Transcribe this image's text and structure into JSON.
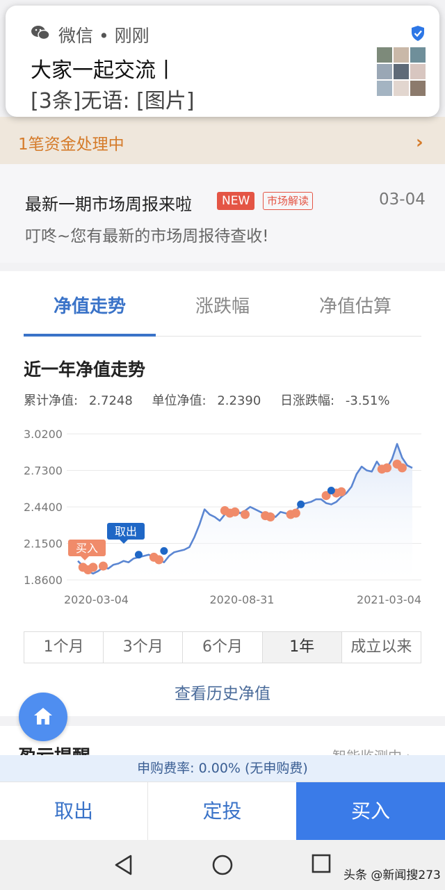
{
  "notification": {
    "app_name": "微信",
    "separator": "•",
    "time": "刚刚",
    "title": "大家一起交流丨",
    "message": "[3条]无语: [图片]"
  },
  "funds_bar": {
    "text": "1笔资金处理中",
    "chevron": "›"
  },
  "report": {
    "title": "最新一期市场周报来啦",
    "badge_new": "NEW",
    "badge_tag": "市场解读",
    "date": "03-04",
    "subtitle": "叮咚~您有最新的市场周报待查收!"
  },
  "tabs": [
    {
      "label": "净值走势",
      "active": true
    },
    {
      "label": "涨跌幅",
      "active": false
    },
    {
      "label": "净值估算",
      "active": false
    }
  ],
  "section_title": "近一年净值走势",
  "metrics": {
    "cumulative_label": "累计净值:",
    "cumulative_value": "2.7248",
    "unit_label": "单位净值:",
    "unit_value": "2.2390",
    "daily_label": "日涨跌幅:",
    "daily_value": "-3.51%"
  },
  "chart_data": {
    "type": "line",
    "y_ticks": [
      "3.0200",
      "2.7300",
      "2.4400",
      "2.1500",
      "1.8600"
    ],
    "ylim": [
      1.86,
      3.02
    ],
    "x_ticks": [
      "2020-03-04",
      "2020-08-31",
      "2021-03-04"
    ],
    "series": [
      {
        "values": [
          2.01,
          1.97,
          1.93,
          1.91,
          1.93,
          1.96,
          1.95,
          1.98,
          1.99,
          2.01,
          2.0,
          2.03,
          2.04,
          2.05,
          2.06,
          2.04,
          2.02,
          2.0,
          2.05,
          2.08,
          2.09,
          2.1,
          2.12,
          2.2,
          2.3,
          2.42,
          2.38,
          2.36,
          2.33,
          2.38,
          2.4,
          2.42,
          2.39,
          2.41,
          2.44,
          2.42,
          2.4,
          2.38,
          2.39,
          2.36,
          2.4,
          2.39,
          2.37,
          2.41,
          2.46,
          2.47,
          2.48,
          2.5,
          2.5,
          2.47,
          2.46,
          2.48,
          2.52,
          2.55,
          2.6,
          2.7,
          2.76,
          2.73,
          2.72,
          2.8,
          2.74,
          2.75,
          2.82,
          2.94,
          2.83,
          2.77,
          2.75
        ]
      }
    ],
    "buy_markers": [
      [
        1,
        1.96
      ],
      [
        2,
        1.94
      ],
      [
        3,
        1.96
      ],
      [
        5,
        1.97
      ],
      [
        15,
        2.04
      ],
      [
        16,
        2.02
      ],
      [
        29,
        2.41
      ],
      [
        30,
        2.39
      ],
      [
        31,
        2.4
      ],
      [
        33,
        2.38
      ],
      [
        37,
        2.37
      ],
      [
        38,
        2.36
      ],
      [
        42,
        2.38
      ],
      [
        43,
        2.39
      ],
      [
        49,
        2.53
      ],
      [
        51,
        2.55
      ],
      [
        52,
        2.56
      ],
      [
        60,
        2.74
      ],
      [
        61,
        2.75
      ],
      [
        63,
        2.78
      ],
      [
        64,
        2.75
      ]
    ],
    "sell_markers": [
      [
        12,
        2.06
      ],
      [
        17,
        2.09
      ],
      [
        44,
        2.46
      ],
      [
        50,
        2.57
      ]
    ],
    "labels": {
      "buy": "买入",
      "sell": "取出"
    },
    "line_color": "#5b86d2",
    "buy_color": "#f08b6a",
    "sell_color": "#1f67c6",
    "grid": true
  },
  "ranges": [
    {
      "label": "1个月",
      "active": false
    },
    {
      "label": "3个月",
      "active": false
    },
    {
      "label": "6个月",
      "active": false
    },
    {
      "label": "1年",
      "active": true
    },
    {
      "label": "成立以来",
      "active": false
    }
  ],
  "history_link": "查看历史净值",
  "peek": {
    "left": "盈亏提醒",
    "right": "智能监测中 ›"
  },
  "fee_bar": "申购费率: 0.00% (无申购费)",
  "actions": {
    "sell": "取出",
    "sip": "定投",
    "buy": "买入"
  },
  "watermark": "头条 @新闻搜273"
}
